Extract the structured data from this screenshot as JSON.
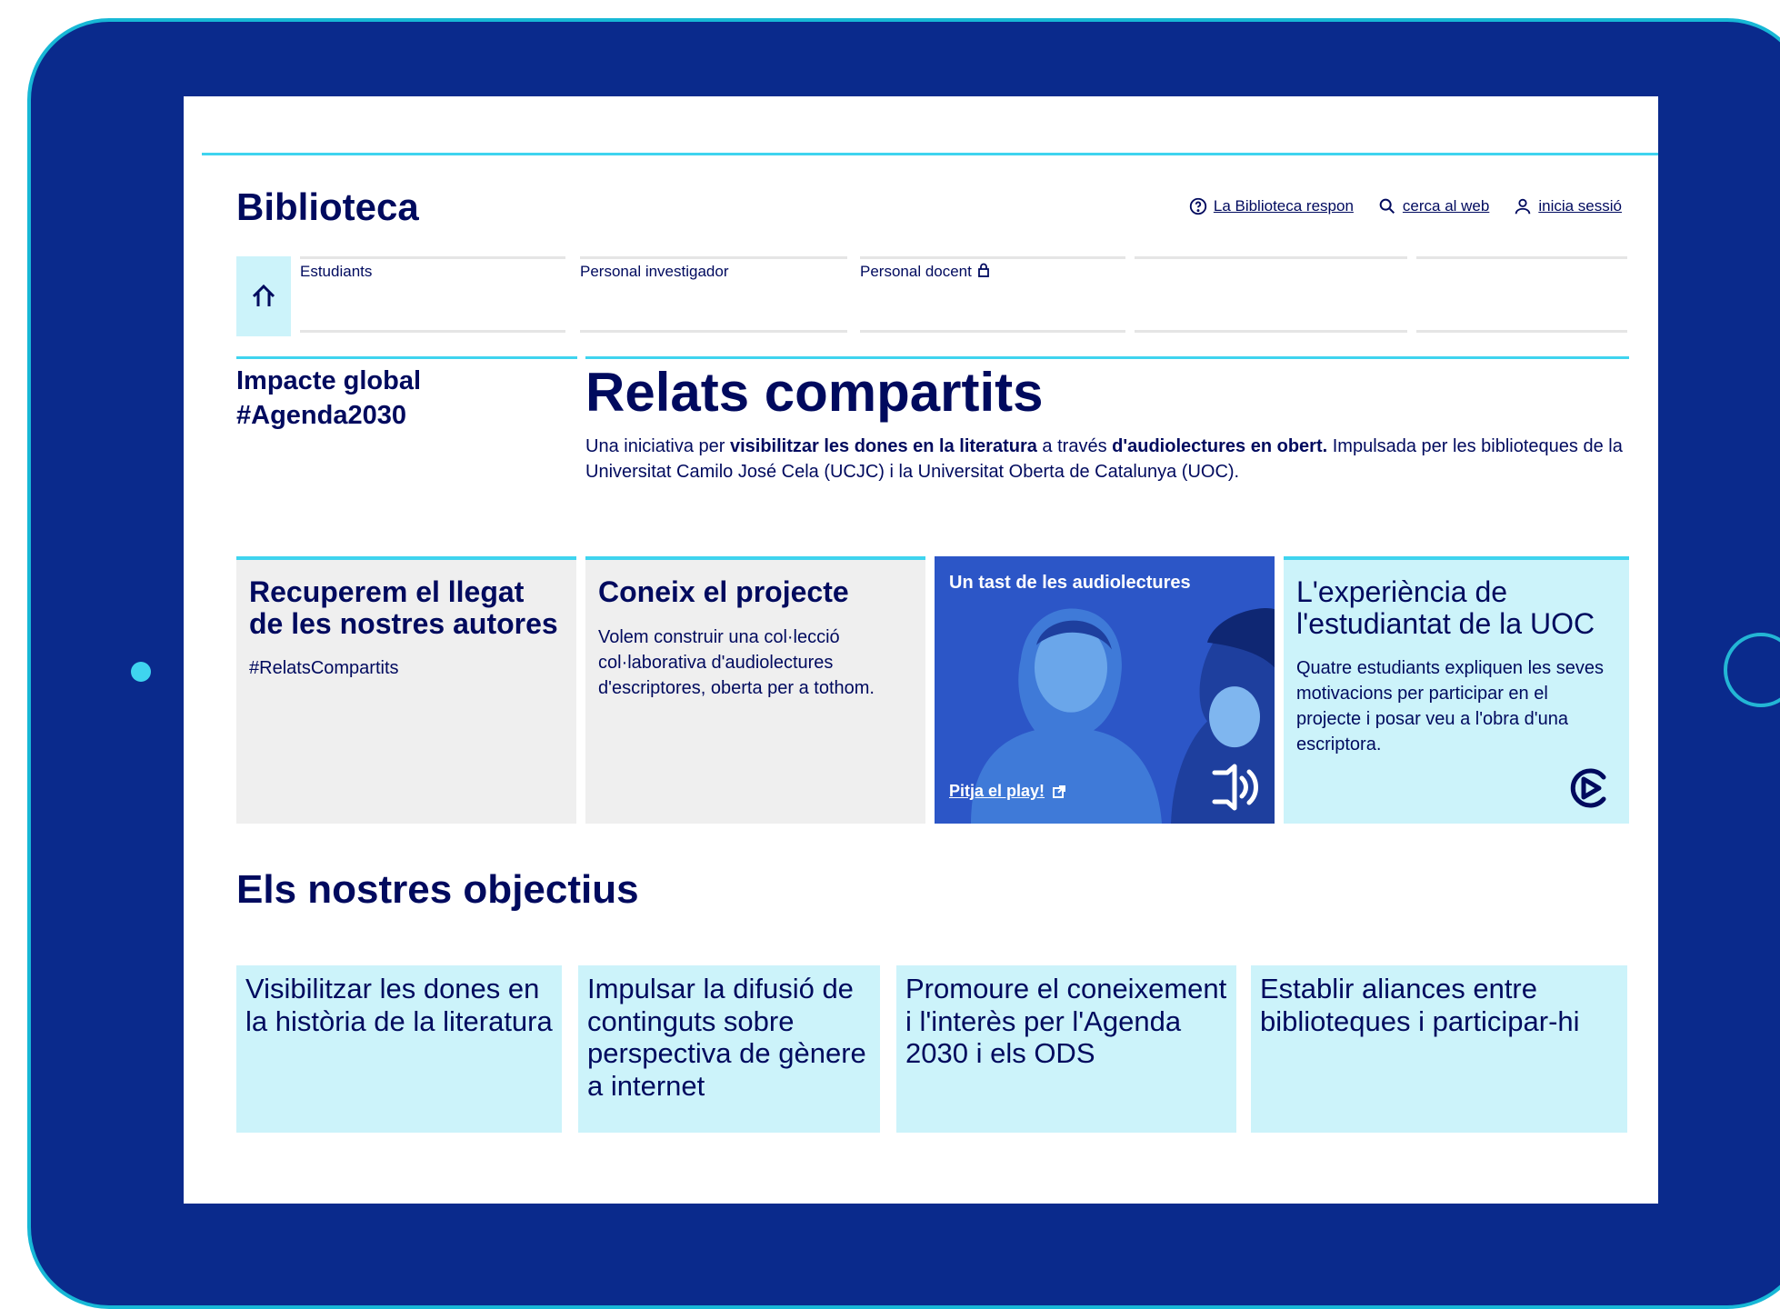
{
  "colors": {
    "navy": "#000a5e",
    "cyan": "#3fd4ef",
    "light_cyan": "#ccf3fa",
    "light_gray": "#efefef",
    "device": "#0a2a8c",
    "media_blue": "#2c56c7"
  },
  "header": {
    "brand": "Biblioteca",
    "utilities": [
      {
        "label": "La Biblioteca respon",
        "icon": "help-circle-icon"
      },
      {
        "label": "cerca al web",
        "icon": "search-icon"
      },
      {
        "label": "inicia sessió",
        "icon": "user-icon"
      }
    ]
  },
  "nav": {
    "home_icon": "home-icon",
    "tabs": [
      {
        "label": "Estudiants"
      },
      {
        "label": "Personal investigador"
      },
      {
        "label": "Personal docent",
        "icon": "lock-icon"
      },
      {
        "label": ""
      },
      {
        "label": ""
      }
    ]
  },
  "sidebar": {
    "title": "Impacte global #Agenda2030"
  },
  "main": {
    "title": "Relats compartits",
    "desc": {
      "p1": "Una iniciativa per ",
      "b1": "visibilitzar les dones en la literatura",
      "p2": " a través ",
      "b2": "d'audiolectures en obert.",
      "p3": " Impulsada per les biblioteques de la Universitat Camilo José Cela (UCJC) i la Universitat Oberta de Catalunya (UOC)."
    }
  },
  "cards": [
    {
      "title": "Recuperem el llegat de les nostres autores",
      "text": "#RelatsCompartits"
    },
    {
      "title": "Coneix el projecte",
      "text": "Volem construir una col·lecció col·laborativa d'audiolectures d'escriptores, oberta per a tothom."
    },
    {
      "title": "Un tast de les audiolectures",
      "link": "Pitja el play!",
      "icon": "speaker-icon"
    },
    {
      "title": "L'experiència de l'estudiantat de la UOC",
      "text": "Quatre estudiants expliquen les seves motivacions per participar en el projecte i posar veu a l'obra d'una escriptora.",
      "icon": "play-icon"
    }
  ],
  "objectives": {
    "title": "Els nostres objectius",
    "items": [
      "Visibilitzar les dones en la història de la literatura",
      "Impulsar la difusió de continguts sobre perspectiva de gènere a internet",
      "Promoure el coneixement i l'interès per l'Agenda 2030 i els ODS",
      "Establir aliances entre biblioteques i participar-hi"
    ]
  }
}
